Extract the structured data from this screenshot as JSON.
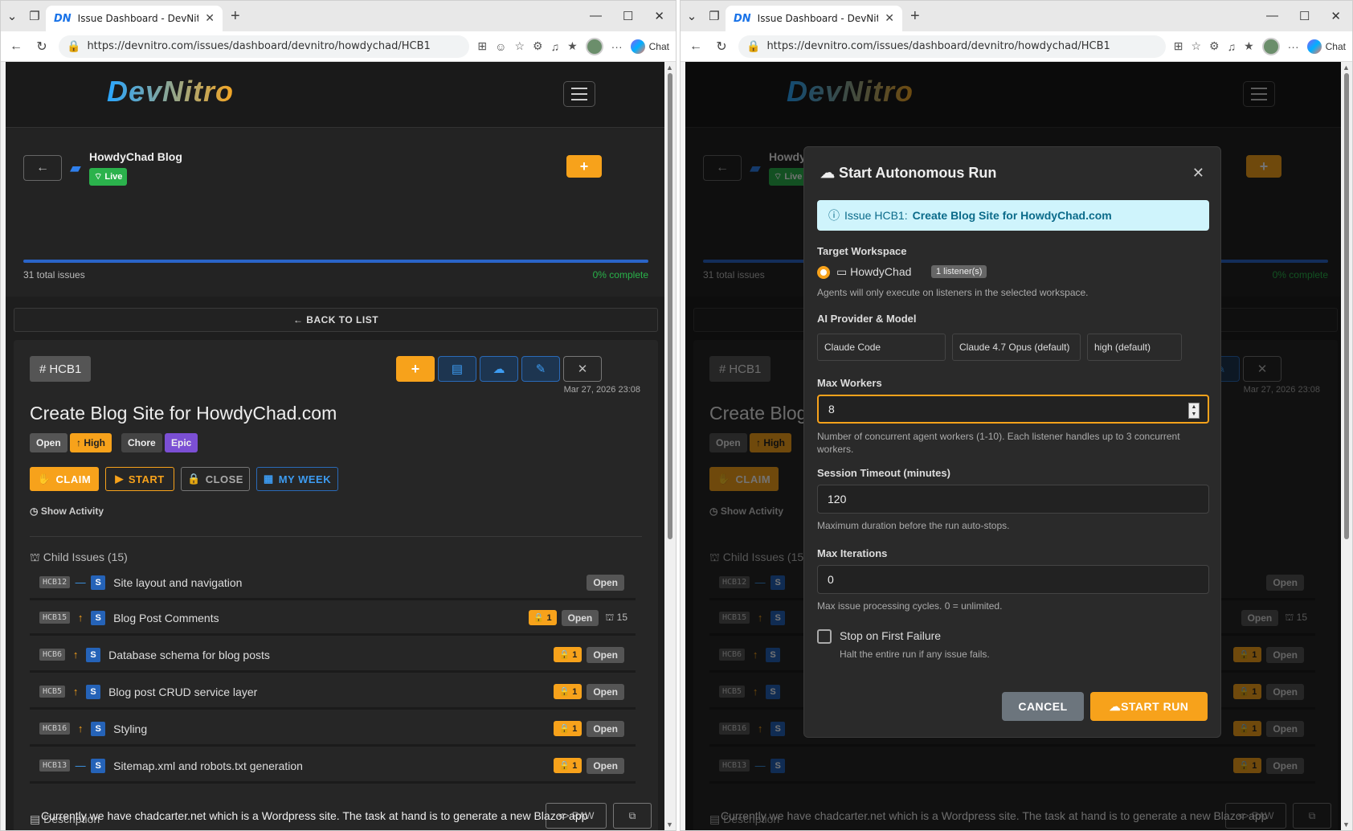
{
  "browser": {
    "tab_title": "Issue Dashboard - DevNitro",
    "url": "https://devnitro.com/issues/dashboard/devnitro/howdychad/HCB1",
    "chat_label": "Chat"
  },
  "app": {
    "brand": "DevNitro",
    "project_name": "HowdyChad Blog",
    "live_label": "Live",
    "total_issues": "31 total issues",
    "complete": "0% complete",
    "back_to_list": "BACK TO LIST"
  },
  "issue": {
    "id": "HCB1",
    "date": "Mar 27, 2026 23:08",
    "title": "Create Blog Site for HowdyChad.com",
    "badges": [
      "Open",
      "High",
      "Chore",
      "Epic"
    ],
    "buttons": {
      "claim": "CLAIM",
      "start": "START",
      "close": "CLOSE",
      "my_week": "MY WEEK"
    },
    "show_activity": "Show Activity",
    "child_header": "Child Issues (15)",
    "children": [
      {
        "id": "HCB12",
        "title": "Site layout and navigation",
        "status": "Open",
        "priority": "—"
      },
      {
        "id": "HCB15",
        "title": "Blog Post Comments",
        "status": "Open",
        "priority": "↑",
        "locks": "1",
        "count": "15"
      },
      {
        "id": "HCB6",
        "title": "Database schema for blog posts",
        "status": "Open",
        "priority": "↑",
        "locks": "1"
      },
      {
        "id": "HCB5",
        "title": "Blog post CRUD service layer",
        "status": "Open",
        "priority": "↑",
        "locks": "1"
      },
      {
        "id": "HCB16",
        "title": "Styling",
        "status": "Open",
        "priority": "↑",
        "locks": "1"
      },
      {
        "id": "HCB13",
        "title": "Sitemap.xml and robots.txt generation",
        "status": "Open",
        "priority": "—",
        "locks": "1"
      }
    ],
    "description_header": "Description",
    "raw_label": "RAW",
    "description_text": "Currently we have chadcarter.net which is a Wordpress site. The task at hand is to generate a new Blazor app"
  },
  "modal": {
    "title": "Start Autonomous Run",
    "info_prefix": "Issue HCB1:",
    "info_link": "Create Blog Site for HowdyChad.com",
    "target_workspace_label": "Target Workspace",
    "workspace": "HowdyChad",
    "listeners": "1 listener(s)",
    "workspace_hint": "Agents will only execute on listeners in the selected workspace.",
    "ai_label": "AI Provider & Model",
    "provider": "Claude Code",
    "model": "Claude 4.7 Opus (default)",
    "effort": "high (default)",
    "max_workers_label": "Max Workers",
    "max_workers": "8",
    "max_workers_hint": "Number of concurrent agent workers (1-10). Each listener handles up to 3 concurrent workers.",
    "timeout_label": "Session Timeout (minutes)",
    "timeout": "120",
    "timeout_hint": "Maximum duration before the run auto-stops.",
    "iterations_label": "Max Iterations",
    "iterations": "0",
    "iterations_hint": "Max issue processing cycles. 0 = unlimited.",
    "stop_label": "Stop on First Failure",
    "stop_hint": "Halt the entire run if any issue fails.",
    "cancel": "CANCEL",
    "start_run": "START RUN"
  }
}
